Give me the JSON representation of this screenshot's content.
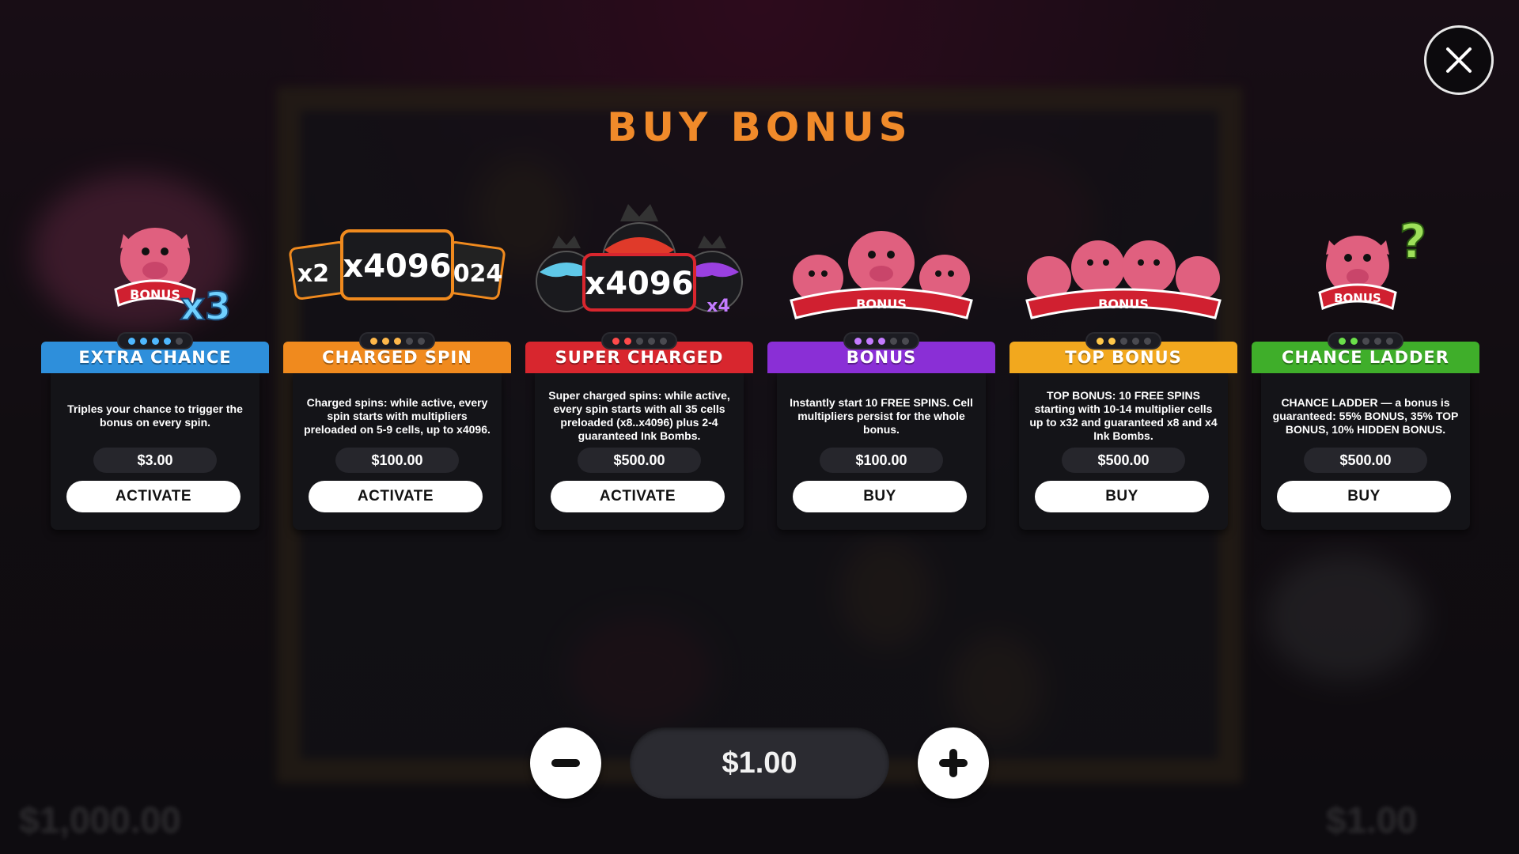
{
  "title": "BUY BONUS",
  "background": {
    "balance_value": "$1,000.00",
    "bet_value": "$1.00"
  },
  "cards": [
    {
      "title": "EXTRA CHANCE",
      "color": "#2e8fdb",
      "dot_color": "#4fb8ff",
      "dots_lit": 4,
      "art_badge": "x3",
      "description": "Triples your chance to trigger the bonus on every spin.",
      "price": "$3.00",
      "action": "ACTIVATE"
    },
    {
      "title": "CHARGED SPIN",
      "color": "#f08a1e",
      "dot_color": "#ffb84a",
      "dots_lit": 3,
      "art_badge": "x4096",
      "art_badge_left": "x2",
      "art_badge_right": "024",
      "description": "Charged spins: while active, every spin starts with multipliers preloaded on 5-9 cells, up to x4096.",
      "price": "$100.00",
      "action": "ACTIVATE"
    },
    {
      "title": "SUPER CHARGED",
      "color": "#d8262e",
      "dot_color": "#ff4a4a",
      "dots_lit": 2,
      "art_badge": "x4096",
      "art_badge_right": "x4",
      "description": "Super charged spins: while active, every spin starts with all 35 cells preloaded (x8..x4096) plus 2-4 guaranteed Ink Bombs.",
      "price": "$500.00",
      "action": "ACTIVATE"
    },
    {
      "title": "BONUS",
      "color": "#8a2fd6",
      "dot_color": "#c47bff",
      "dots_lit": 3,
      "art_badge": "",
      "description": "Instantly start 10 FREE SPINS. Cell multipliers persist for the whole bonus.",
      "price": "$100.00",
      "action": "BUY"
    },
    {
      "title": "TOP BONUS",
      "color": "#f2a81e",
      "dot_color": "#ffc84a",
      "dots_lit": 2,
      "art_badge": "",
      "description": "TOP BONUS: 10 FREE SPINS starting with 10-14 multiplier cells up to x32 and guaranteed x8 and x4 Ink Bombs.",
      "price": "$500.00",
      "action": "BUY"
    },
    {
      "title": "CHANCE LADDER",
      "color": "#3fae2a",
      "dot_color": "#6be04a",
      "dots_lit": 2,
      "art_badge": "?",
      "description": "CHANCE LADDER — a bonus is guaranteed: 55% BONUS, 35% TOP BONUS, 10% HIDDEN BONUS.",
      "price": "$500.00",
      "action": "BUY"
    }
  ],
  "bet": {
    "value": "$1.00",
    "decrease_icon": "minus-icon",
    "increase_icon": "plus-icon"
  },
  "icons": {
    "close": "close-icon"
  }
}
